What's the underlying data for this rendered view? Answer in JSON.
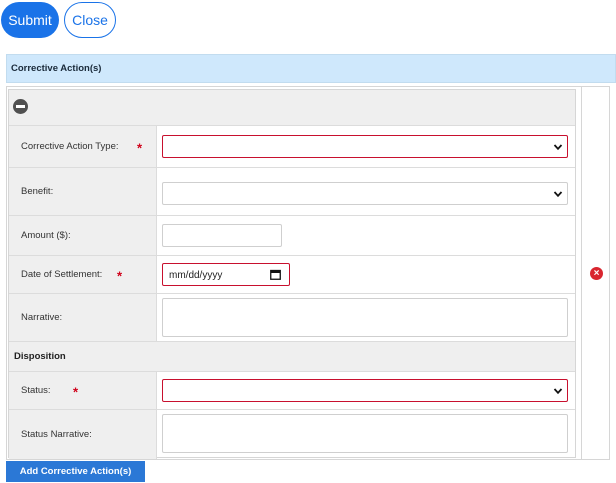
{
  "actions": {
    "submit_label": "Submit",
    "close_label": "Close"
  },
  "section": {
    "title": "Corrective Action(s)"
  },
  "form": {
    "corrective_action_type_label": "Corrective Action Type:",
    "benefit_label": "Benefit:",
    "amount_label": "Amount ($):",
    "date_of_settlement_label": "Date of Settlement:",
    "date_placeholder": "mm/dd/yyyy",
    "narrative_label": "Narrative:",
    "disposition_heading": "Disposition",
    "status_label": "Status:",
    "status_narrative_label": "Status Narrative:",
    "required_marker": "*"
  },
  "footer": {
    "add_label": "Add Corrective Action(s)"
  },
  "colors": {
    "primary": "#1a73e8",
    "error": "#c8102e",
    "required": "#d0021b",
    "header_bg": "#cfe8fc"
  },
  "icons": {
    "collapse": "minus-circle-icon",
    "remove": "x-circle-icon",
    "calendar": "calendar-icon",
    "chevron": "chevron-down-icon"
  }
}
